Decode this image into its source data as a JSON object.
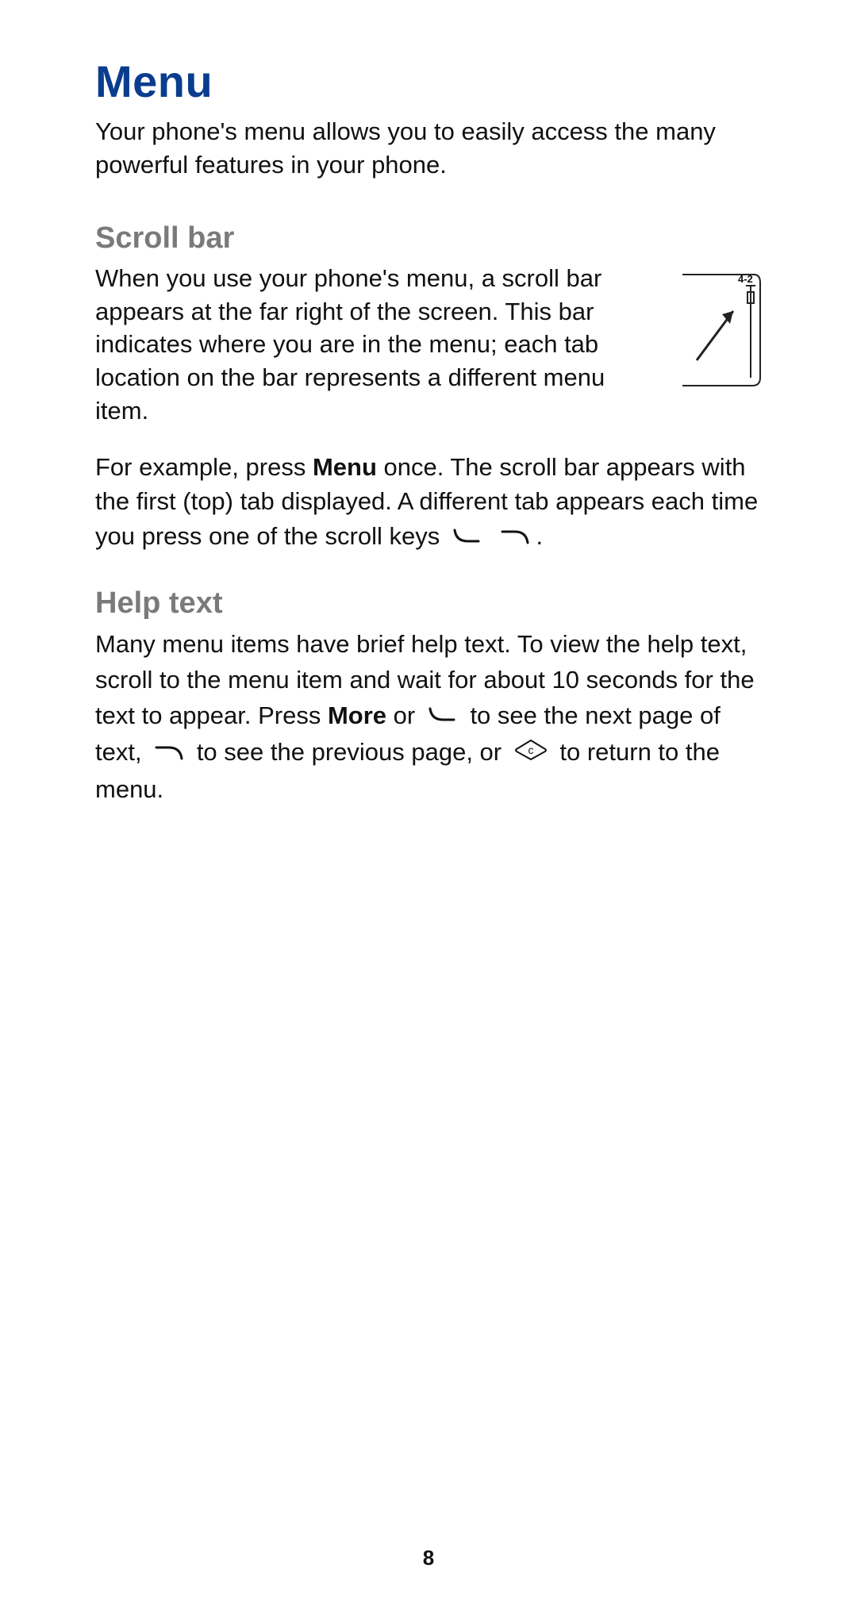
{
  "title": "Menu",
  "intro": "Your phone's menu allows you to easily access the many powerful features in your phone.",
  "scroll_bar": {
    "heading": "Scroll bar",
    "para1": "When you use your phone's menu, a scroll bar appears at the far right of the screen. This bar indicates where you are in the menu; each tab location on the bar represents a different menu item.",
    "para2_pre": "For example, press ",
    "menu_bold": "Menu",
    "para2_mid": " once. The scroll bar appears with the first (top) tab displayed. A different tab appears each time you press one of the scroll keys ",
    "para2_end": ".",
    "illustration_label": "4-2"
  },
  "help_text": {
    "heading": "Help text",
    "p_a": "Many menu items have brief help text. To view the help text, scroll to the menu item and wait for about 10 seconds for the text to appear. Press ",
    "more_bold": "More",
    "p_b": " or ",
    "p_c": " to see the next page of text, ",
    "p_d": " to see the previous page, or ",
    "p_e": " to return to the menu."
  },
  "page_number": "8"
}
